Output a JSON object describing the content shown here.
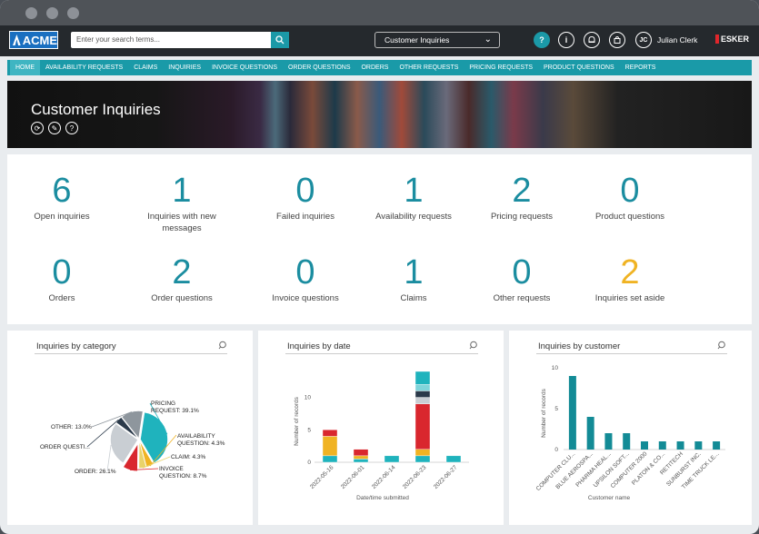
{
  "titlebar": {
    "dots": 3
  },
  "topbar": {
    "logo": "ACME",
    "search_placeholder": "Enter your search terms...",
    "view_select": "Customer Inquiries",
    "user_initials": "JC",
    "user_name": "Julian Clerk",
    "brand": "ESKER"
  },
  "nav": {
    "items": [
      "HOME",
      "AVAILABILITY REQUESTS",
      "CLAIMS",
      "INQUIRIES",
      "INVOICE QUESTIONS",
      "ORDER QUESTIONS",
      "ORDERS",
      "OTHER REQUESTS",
      "PRICING REQUESTS",
      "PRODUCT QUESTIONS",
      "REPORTS"
    ]
  },
  "hero": {
    "title": "Customer Inquiries"
  },
  "stats": [
    {
      "value": "6",
      "label": "Open inquiries"
    },
    {
      "value": "1",
      "label": "Inquiries with new messages"
    },
    {
      "value": "0",
      "label": "Failed inquiries"
    },
    {
      "value": "1",
      "label": "Availability requests"
    },
    {
      "value": "2",
      "label": "Pricing requests"
    },
    {
      "value": "0",
      "label": "Product questions"
    },
    {
      "value": "0",
      "label": "Orders"
    },
    {
      "value": "2",
      "label": "Order questions"
    },
    {
      "value": "0",
      "label": "Invoice questions"
    },
    {
      "value": "1",
      "label": "Claims"
    },
    {
      "value": "0",
      "label": "Other requests"
    },
    {
      "value": "2",
      "label": "Inquiries set aside"
    }
  ],
  "panels": {
    "category_title": "Inquiries by category",
    "date_title": "Inquiries by date",
    "customer_title": "Inquiries by customer"
  },
  "chart_data": [
    {
      "type": "pie",
      "title": "Inquiries by category",
      "labels": [
        "PRICING REQUEST: 39.1%",
        "AVAILABILITY QUESTION: 4.3%",
        "CLAIM: 4.3%",
        "INVOICE QUESTION: 8.7%",
        "ORDER: 26.1%",
        "ORDER QUESTI...",
        "OTHER: 13.0%"
      ],
      "values": [
        39.1,
        4.3,
        4.3,
        8.7,
        26.1,
        4.3,
        13.0
      ],
      "colors": [
        "#1fb3bd",
        "#f0b323",
        "#e9d36a",
        "#d9272e",
        "#c9ced3",
        "#2b3a4a",
        "#8e969d"
      ]
    },
    {
      "type": "bar",
      "title": "Inquiries by date",
      "xlabel": "Date/time submitted",
      "ylabel": "Number of records",
      "categories": [
        "2022-05-16",
        "2022-06-01",
        "2022-06-14",
        "2022-06-23",
        "2022-06-27"
      ],
      "yticks": [
        "0",
        "5",
        "10"
      ],
      "ylim": [
        0,
        14
      ],
      "series": [
        {
          "values": [
            1,
            0.5,
            1,
            1,
            1
          ],
          "color": "#1fb3bd"
        },
        {
          "values": [
            3,
            0.5,
            0,
            1,
            0
          ],
          "color": "#f0b323"
        },
        {
          "values": [
            1,
            1,
            0,
            7,
            0
          ],
          "color": "#d9272e"
        },
        {
          "values": [
            0,
            0,
            0,
            1,
            0
          ],
          "color": "#c9ced3"
        },
        {
          "values": [
            0,
            0,
            0,
            1,
            0
          ],
          "color": "#2b3a4a"
        },
        {
          "values": [
            0,
            0,
            0,
            1,
            0
          ],
          "color": "#7fd4da"
        },
        {
          "values": [
            0,
            0,
            0,
            2,
            0
          ],
          "color": "#1fb3bd"
        }
      ]
    },
    {
      "type": "bar",
      "title": "Inquiries by customer",
      "xlabel": "Customer name",
      "ylabel": "Number of records",
      "categories": [
        "COMPUTER CLU...",
        "BLUE AEROSPA...",
        "PHARMA HEAL...",
        "UPSILON SOFT...",
        "COMPUTER 2000",
        "PLATON & CO...",
        "RETITECH",
        "SUNBURST INC.",
        "TIME TRUCK LE..."
      ],
      "values": [
        9,
        4,
        2,
        2,
        1,
        1,
        1,
        1,
        1
      ],
      "yticks": [
        "0",
        "5",
        "10"
      ],
      "ylim": [
        0,
        10
      ],
      "color": "#138b96"
    }
  ]
}
